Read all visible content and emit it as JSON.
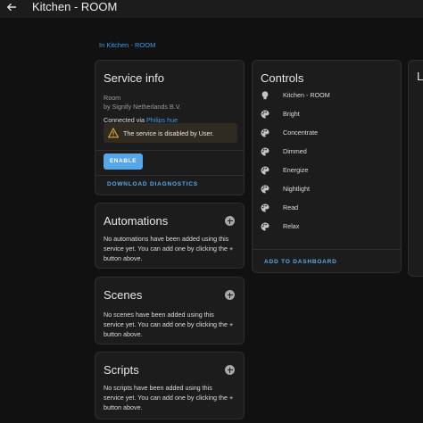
{
  "header": {
    "title": "Kitchen - ROOM"
  },
  "breadcrumb": "In Kitchen - ROOM",
  "service_info": {
    "title": "Service info",
    "name": "Room",
    "manufacturer": "by Signify Netherlands B.V.",
    "connected_via_prefix": "Connected via ",
    "connected_via_link": "Philips hue",
    "warning": "The service is disabled by User.",
    "enable_label": "ENABLE",
    "download_label": "DOWNLOAD DIAGNOSTICS"
  },
  "automations": {
    "title": "Automations",
    "line1": "No automations have been added using this",
    "line2": "service yet. You can add one by clicking the +",
    "line3": "button above."
  },
  "scenes": {
    "title": "Scenes",
    "line1": "No scenes have been added using this",
    "line2": "service yet. You can add one by clicking the +",
    "line3": "button above."
  },
  "scripts": {
    "title": "Scripts",
    "line1": "No scripts have been added using this",
    "line2": "service yet. You can add one by clicking the +",
    "line3": "button above."
  },
  "controls": {
    "title": "Controls",
    "items": [
      {
        "label": "Kitchen - ROOM",
        "icon": "lightbulb-icon"
      },
      {
        "label": "Bright",
        "icon": "palette-icon"
      },
      {
        "label": "Concentrate",
        "icon": "palette-icon"
      },
      {
        "label": "Dimmed",
        "icon": "palette-icon"
      },
      {
        "label": "Energize",
        "icon": "palette-icon"
      },
      {
        "label": "Nightlight",
        "icon": "palette-icon"
      },
      {
        "label": "Read",
        "icon": "palette-icon"
      },
      {
        "label": "Relax",
        "icon": "palette-icon"
      }
    ],
    "add_label": "ADD TO DASHBOARD"
  },
  "logbook": {
    "title": "L"
  },
  "colors": {
    "accent": "#56a6e8",
    "link": "#3d9be6",
    "warning": "#e0a53a",
    "card": "#1c1c1c",
    "background": "#111111"
  }
}
